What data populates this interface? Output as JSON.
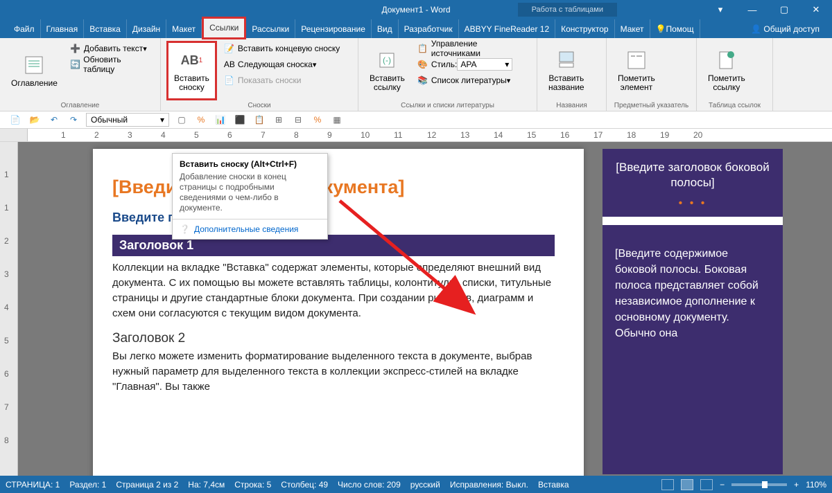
{
  "title": "Документ1 - Word",
  "context_tab": "Работа с таблицами",
  "menu": {
    "file": "Файл",
    "home": "Главная",
    "insert": "Вставка",
    "design": "Дизайн",
    "layout": "Макет",
    "references": "Ссылки",
    "mailings": "Рассылки",
    "review": "Рецензирование",
    "view": "Вид",
    "developer": "Разработчик",
    "abbyy": "ABBYY FineReader 12",
    "constructor": "Конструктор",
    "layout2": "Макет",
    "help": "Помощ",
    "share": "Общий доступ"
  },
  "ribbon": {
    "toc": {
      "label": "Оглавление",
      "big": "Оглавление",
      "add": "Добавить текст",
      "update": "Обновить таблицу"
    },
    "footnotes": {
      "label": "Сноски",
      "insert_big": "Вставить\nсноску",
      "ab": "AB",
      "end": "Вставить концевую сноску",
      "next": "Следующая сноска",
      "show": "Показать сноски"
    },
    "citations": {
      "label": "Ссылки и списки литературы",
      "insert": "Вставить\nссылку",
      "manage": "Управление источниками",
      "style_lbl": "Стиль:",
      "style_val": "APA",
      "biblio": "Список литературы"
    },
    "captions": {
      "label": "Названия",
      "insert": "Вставить\nназвание"
    },
    "index": {
      "label": "Предметный указатель",
      "mark": "Пометить\nэлемент"
    },
    "toa": {
      "label": "Таблица ссылок",
      "mark": "Пометить\nссылку"
    }
  },
  "qat": {
    "style": "Обычный"
  },
  "tooltip": {
    "title": "Вставить сноску (Alt+Ctrl+F)",
    "body": "Добавление сноски в конец страницы с подробными сведениями о чем-либо в документе.",
    "more": "Дополнительные сведения"
  },
  "doc": {
    "title": "[Введите заголовок документа]",
    "subtitle": "Введите подзаголовок документа",
    "h1": "Заголовок 1",
    "p1": "Коллекции на вкладке \"Вставка\" содержат элементы, которые определяют внешний вид документа. С их помощью вы можете вставлять таблицы, колонтитулы, списки, титульные страницы и другие стандартные блоки документа. При создании рисунков, диаграмм и схем они согласуются с текущим видом документа.",
    "h2": "Заголовок 2",
    "p2": "Вы легко можете изменить форматирование выделенного текста в документе, выбрав нужный параметр для выделенного текста в коллекции экспресс-стилей на вкладке \"Главная\". Вы также",
    "side_title": "[Введите заголовок боковой полосы]",
    "side_body": "[Введите содержимое боковой полосы. Боковая полоса представляет собой независимое дополнение к основному документу. Обычно она"
  },
  "status": {
    "page": "СТРАНИЦА: 1",
    "section": "Раздел: 1",
    "pages": "Страница 2 из 2",
    "pos": "На: 7,4см",
    "line": "Строка: 5",
    "col": "Столбец: 49",
    "words": "Число слов: 209",
    "lang": "русский",
    "track": "Исправления: Выкл.",
    "mode": "Вставка",
    "zoom": "110%"
  },
  "ruler_marks": [
    "1",
    "2",
    "3",
    "4",
    "5",
    "6",
    "7",
    "8",
    "9",
    "10",
    "11",
    "12",
    "13",
    "14",
    "15",
    "16",
    "17",
    "18",
    "19",
    "20"
  ]
}
